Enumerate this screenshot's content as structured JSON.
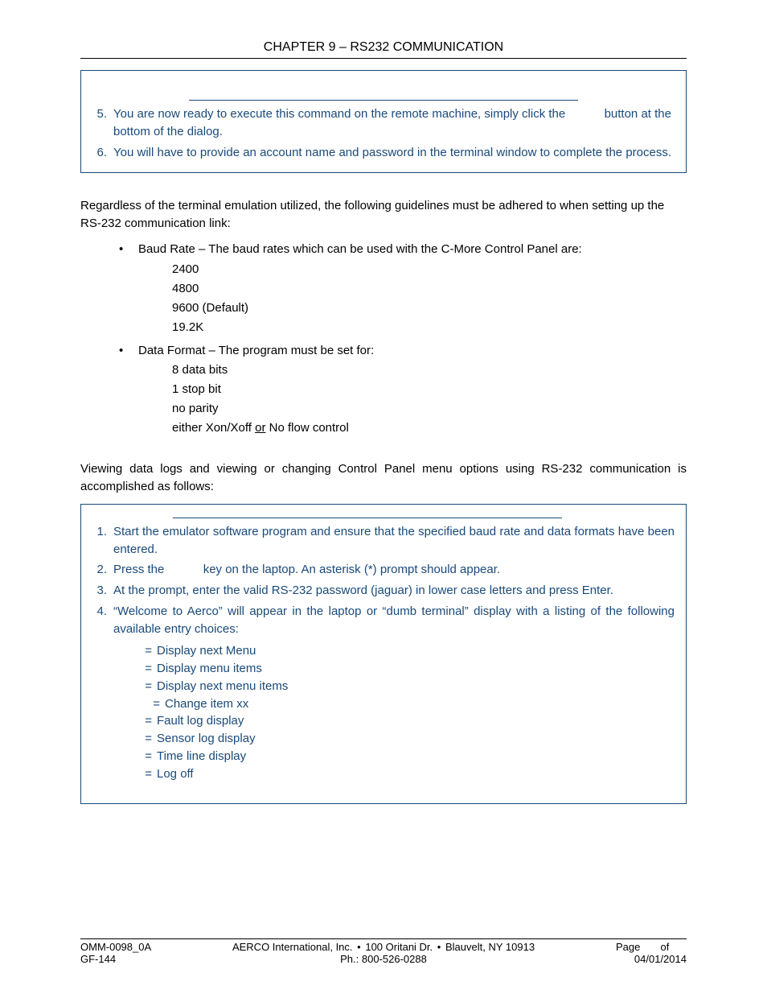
{
  "header": {
    "chapter_title": "CHAPTER 9 – RS232 COMMUNICATION"
  },
  "box1": {
    "steps": [
      {
        "num": "5.",
        "text_a": "You are now ready to execute this command on the remote machine, simply click the ",
        "text_b": " button at the bottom of the dialog."
      },
      {
        "num": "6.",
        "text": "You will have to provide an account name and password in the terminal window to complete the process."
      }
    ]
  },
  "para1": "Regardless of the terminal emulation utilized, the following guidelines must be adhered to when setting up the RS-232 communication link:",
  "bullet1": {
    "lead": "Baud Rate – The baud rates which can be used with the C-More Control Panel are:",
    "items": [
      "2400",
      "4800",
      "9600 (Default)",
      "19.2K"
    ]
  },
  "bullet2": {
    "lead": "Data Format – The program must be set for:",
    "items": [
      "8 data bits",
      "1 stop bit",
      "no parity"
    ],
    "last_a": "either Xon/Xoff ",
    "last_or": "or",
    "last_b": " No flow control"
  },
  "para2": "Viewing data logs and viewing or changing Control Panel menu options using RS-232 communication is accomplished as follows:",
  "box2": {
    "steps": [
      {
        "num": "1.",
        "just": true,
        "text": "Start the emulator software program and ensure that the specified baud rate and data formats have been entered."
      },
      {
        "num": "2.",
        "text_a": "Press the ",
        "text_b": " key on the laptop. An asterisk (*) prompt should appear."
      },
      {
        "num": "3.",
        "just": true,
        "text": "At the prompt, enter the valid RS-232 password (jaguar) in lower case letters and press Enter."
      },
      {
        "num": "4.",
        "just": true,
        "text": "“Welcome to Aerco” will appear in the laptop or “dumb terminal” display with a listing of the following available entry choices:"
      }
    ],
    "entries": [
      {
        "indent": false,
        "label": "Display next Menu"
      },
      {
        "indent": false,
        "label": "Display menu items"
      },
      {
        "indent": false,
        "label": "Display next menu items"
      },
      {
        "indent": true,
        "label": "Change item xx"
      },
      {
        "indent": false,
        "label": "Fault log display"
      },
      {
        "indent": false,
        "label": "Sensor log display"
      },
      {
        "indent": false,
        "label": "Time line display"
      },
      {
        "indent": false,
        "label": "Log off"
      }
    ]
  },
  "footer": {
    "left1": "OMM-0098_0A",
    "left2": "GF-144",
    "center1a": "AERCO International, Inc.",
    "center1b": "100 Oritani Dr.",
    "center1c": "Blauvelt, NY 10913",
    "center2": "Ph.: 800-526-0288",
    "right1a": "Page ",
    "right1b": " of ",
    "right2": "04/01/2014"
  }
}
